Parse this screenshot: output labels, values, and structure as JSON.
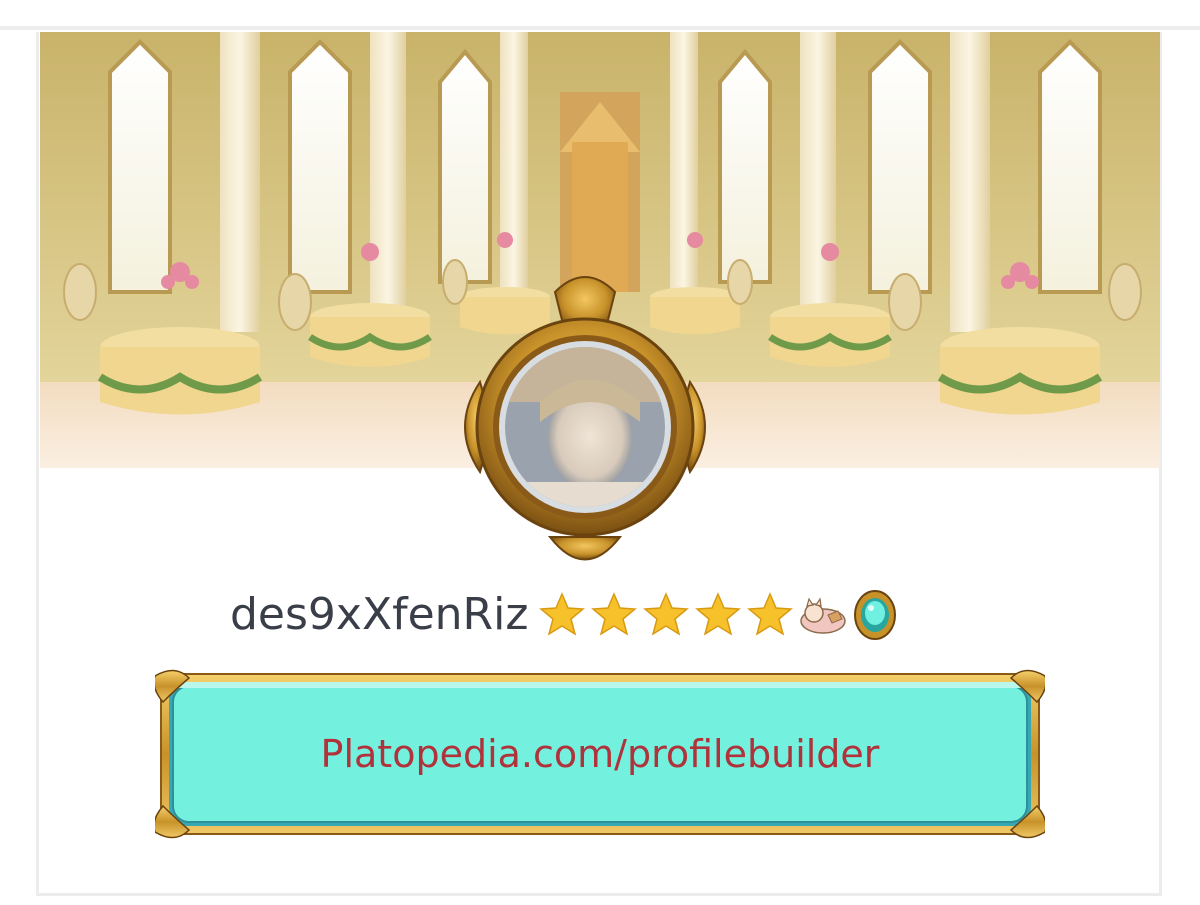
{
  "profile": {
    "username": "des9xXfenRiz",
    "rating_stars": 5,
    "rating_max": 5
  },
  "icons": {
    "star": "star-icon",
    "pet_badge": "cat-badge-icon",
    "gem_badge": "gem-badge-icon",
    "frame": "ornate-gold-frame"
  },
  "nameplate": {
    "text": "Platopedia.com/profilebuilder"
  },
  "colors": {
    "plate_fill": "#74f0de",
    "plate_text": "#b0323a",
    "gold": "#c8922a",
    "username": "#3a3e48",
    "banner_wall": "#e8d8a0"
  }
}
